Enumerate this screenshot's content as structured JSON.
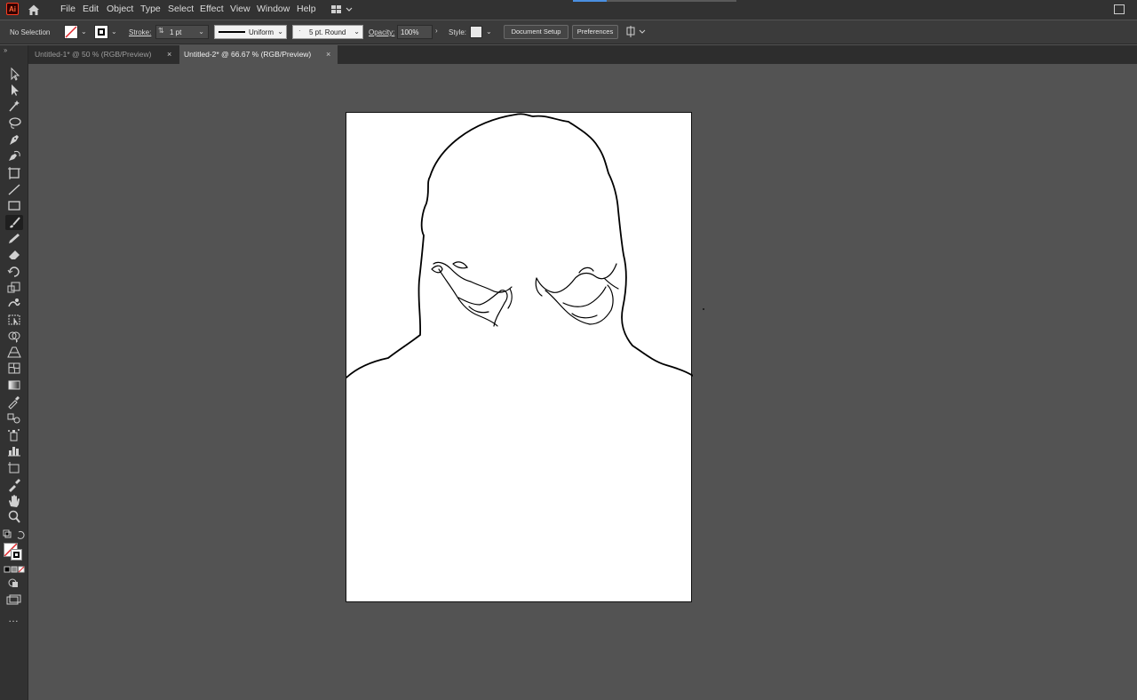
{
  "app": {
    "logo_text": "Ai"
  },
  "menu": [
    "File",
    "Edit",
    "Object",
    "Type",
    "Select",
    "Effect",
    "View",
    "Window",
    "Help"
  ],
  "control": {
    "selection": "No Selection",
    "stroke_label": "Stroke:",
    "stroke_weight": "1 pt",
    "profile": "Uniform",
    "brush": "5 pt. Round",
    "opacity_label": "Opacity:",
    "opacity": "100%",
    "style_label": "Style:",
    "doc_setup": "Document Setup",
    "preferences": "Preferences"
  },
  "tabs": [
    {
      "label": "Untitled-1* @ 50 % (RGB/Preview)",
      "active": false
    },
    {
      "label": "Untitled-2* @ 66.67 % (RGB/Preview)",
      "active": true
    }
  ],
  "tab_close": "×",
  "tools": [
    "selection-tool",
    "direct-selection-tool",
    "magic-wand-tool",
    "lasso-tool",
    "pen-tool",
    "curvature-tool",
    "artboard-tool",
    "line-tool",
    "rectangle-tool",
    "paintbrush-tool",
    "pencil-tool",
    "eraser-tool",
    "rotate-tool",
    "scale-tool",
    "warp-tool",
    "free-transform-tool",
    "shape-builder-tool",
    "perspective-grid-tool",
    "mesh-tool",
    "gradient-tool",
    "eyedropper-tool",
    "blend-tool",
    "symbol-sprayer-tool",
    "column-graph-tool",
    "slice-tool",
    "eyedropper-alt-tool",
    "hand-tool",
    "zoom-tool"
  ],
  "more_tools": "…",
  "colors": {
    "ui_bg": "#535353",
    "menubar": "#323232",
    "artboard": "#ffffff",
    "stroke": "#000000"
  }
}
